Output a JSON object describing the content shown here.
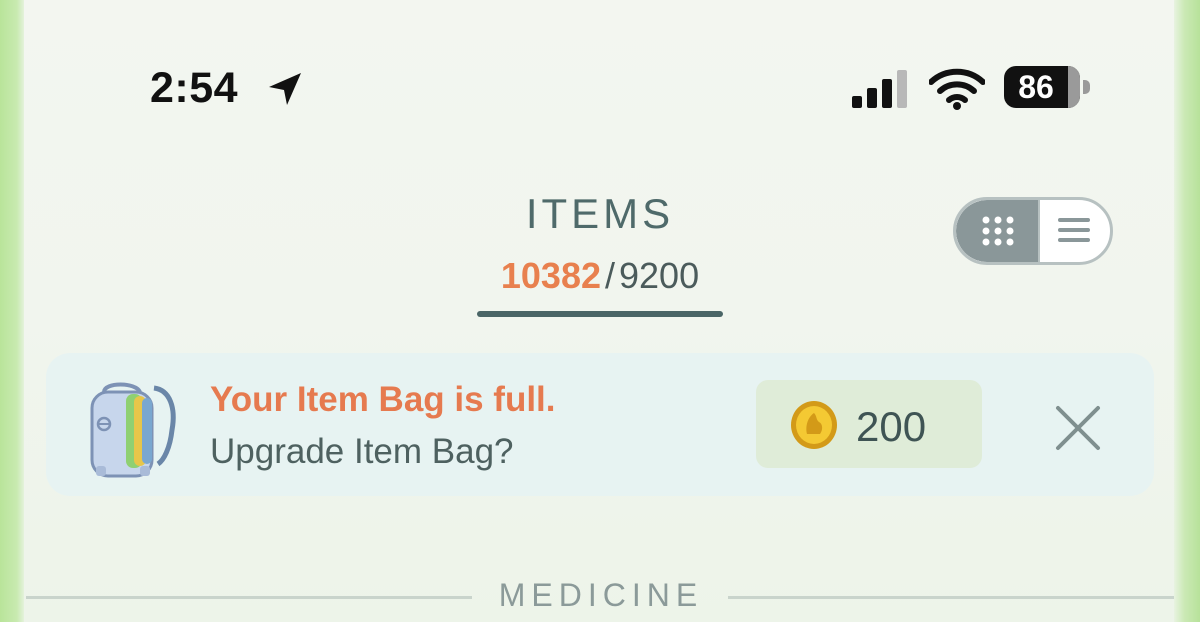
{
  "status_bar": {
    "time": "2:54",
    "battery_level": "86",
    "icons": [
      "location-arrow-icon",
      "cellular-signal-icon",
      "wifi-icon",
      "battery-icon"
    ]
  },
  "header": {
    "title": "ITEMS",
    "count_current": "10382",
    "count_separator": "/",
    "count_max": "9200",
    "view_toggle": {
      "grid_icon": "grid-view-icon",
      "list_icon": "list-view-icon",
      "selected": "grid"
    }
  },
  "banner": {
    "icon": "item-bag-icon",
    "title": "Your Item Bag is full.",
    "subtitle": "Upgrade Item Bag?",
    "price_icon": "pokecoin-icon",
    "price": "200",
    "close_icon": "close-icon"
  },
  "section": {
    "title": "MEDICINE"
  },
  "colors": {
    "accent_orange": "#e67a4f",
    "text_slate": "#4f6a6a",
    "banner_bg": "#e7f3f2",
    "price_bg": "#dfecd8",
    "frame_green": "#b9e49a"
  }
}
